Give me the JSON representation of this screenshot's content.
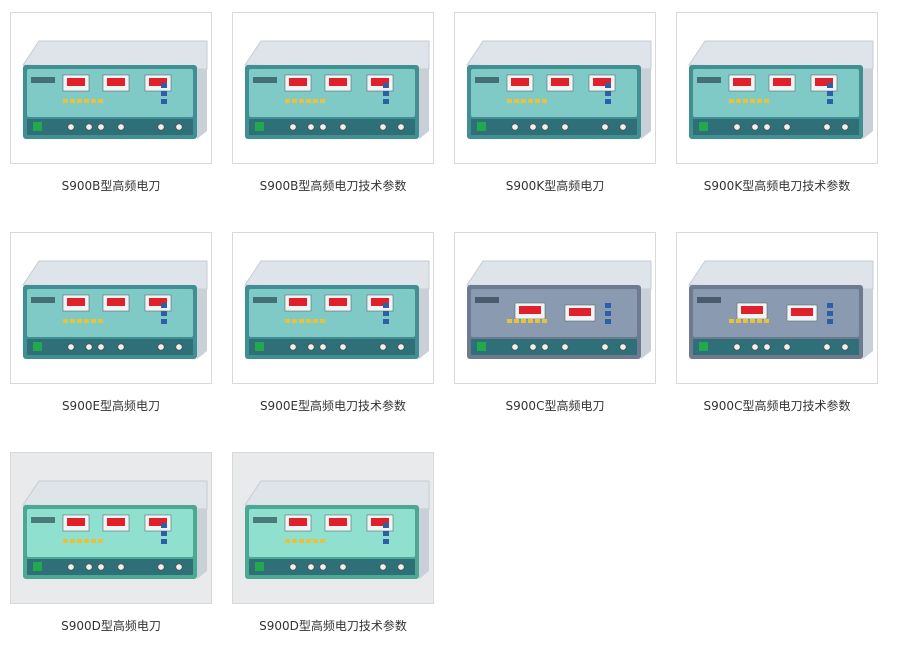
{
  "products": [
    {
      "caption": "S900B型高频电刀",
      "variant": "teal",
      "thumb_bg": "white"
    },
    {
      "caption": "S900B型高频电刀技术参数",
      "variant": "teal",
      "thumb_bg": "white"
    },
    {
      "caption": "S900K型高频电刀",
      "variant": "teal",
      "thumb_bg": "white"
    },
    {
      "caption": "S900K型高频电刀技术参数",
      "variant": "teal",
      "thumb_bg": "white"
    },
    {
      "caption": "S900E型高频电刀",
      "variant": "teal",
      "thumb_bg": "white"
    },
    {
      "caption": "S900E型高频电刀技术参数",
      "variant": "teal",
      "thumb_bg": "white"
    },
    {
      "caption": "S900C型高频电刀",
      "variant": "grey",
      "thumb_bg": "white"
    },
    {
      "caption": "S900C型高频电刀技术参数",
      "variant": "grey",
      "thumb_bg": "white"
    },
    {
      "caption": "S900D型高频电刀",
      "variant": "green",
      "thumb_bg": "grey"
    },
    {
      "caption": "S900D型高频电刀技术参数",
      "variant": "green",
      "thumb_bg": "grey"
    }
  ],
  "colors": {
    "teal_panel": "#7fc9c6",
    "teal_frame": "#3f8f93",
    "grey_panel": "#8a9ab0",
    "green_panel": "#8fe0cf",
    "led": "#e0202a",
    "case": "#dfe4ea"
  }
}
